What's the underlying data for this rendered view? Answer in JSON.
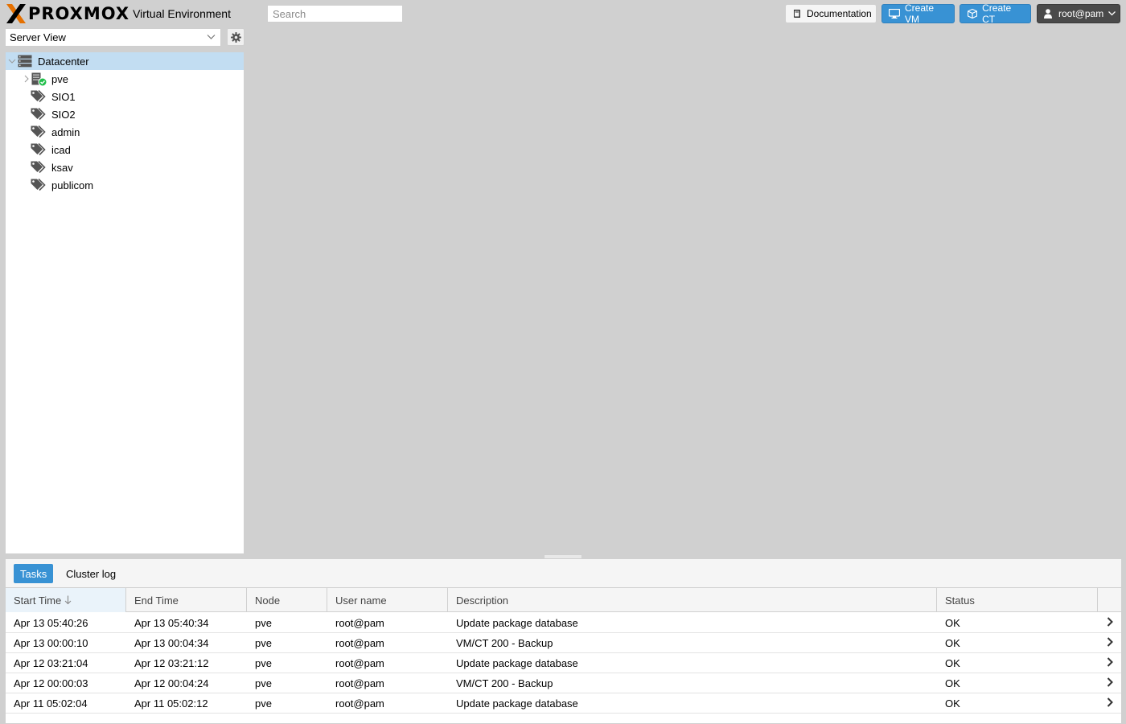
{
  "header": {
    "logo_text": "PROXMOX",
    "product_name": "Virtual Environment",
    "search_placeholder": "Search",
    "documentation_label": "Documentation",
    "create_vm_label": "Create VM",
    "create_ct_label": "Create CT",
    "user_label": "root@pam"
  },
  "sidebar": {
    "view_selected": "Server View",
    "tree": [
      {
        "label": "Datacenter",
        "type": "datacenter",
        "selected": true
      },
      {
        "label": "pve",
        "type": "node",
        "status": "online"
      },
      {
        "label": "SIO1",
        "type": "pool"
      },
      {
        "label": "SIO2",
        "type": "pool"
      },
      {
        "label": "admin",
        "type": "pool"
      },
      {
        "label": "icad",
        "type": "pool"
      },
      {
        "label": "ksav",
        "type": "pool"
      },
      {
        "label": "publicom",
        "type": "pool"
      }
    ]
  },
  "bottom_panel": {
    "tabs": [
      "Tasks",
      "Cluster log"
    ],
    "active_tab": "Tasks",
    "columns": [
      "Start Time",
      "End Time",
      "Node",
      "User name",
      "Description",
      "Status"
    ],
    "sorted_column": "Start Time",
    "rows": [
      [
        "Apr 13 05:40:26",
        "Apr 13 05:40:34",
        "pve",
        "root@pam",
        "Update package database",
        "OK"
      ],
      [
        "Apr 13 00:00:10",
        "Apr 13 00:04:34",
        "pve",
        "root@pam",
        "VM/CT 200 - Backup",
        "OK"
      ],
      [
        "Apr 12 03:21:04",
        "Apr 12 03:21:12",
        "pve",
        "root@pam",
        "Update package database",
        "OK"
      ],
      [
        "Apr 12 00:00:03",
        "Apr 12 00:04:24",
        "pve",
        "root@pam",
        "VM/CT 200 - Backup",
        "OK"
      ],
      [
        "Apr 11 05:02:04",
        "Apr 11 05:02:12",
        "pve",
        "root@pam",
        "Update package database",
        "OK"
      ]
    ]
  },
  "colors": {
    "accent": "#3892d4",
    "logo_orange": "#e57000",
    "background": "#d0d0d0",
    "selection": "#c2ddf2",
    "status_ok": "#21bf4b"
  }
}
